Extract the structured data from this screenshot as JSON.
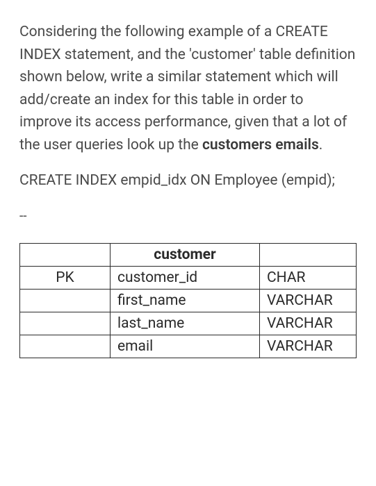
{
  "question": {
    "intro": "Considering the following example of a CREATE INDEX statement, and the 'customer' table definition shown below, write a similar statement which will add/create an index for this table in order to improve its access performance, given that a lot of the user queries look up the ",
    "bold_part": "customers emails",
    "tail": "."
  },
  "code_example": "CREATE INDEX empid_idx ON Employee (empid);",
  "separator": "--",
  "table": {
    "title": "customer",
    "rows": [
      {
        "key": "PK",
        "name": "customer_id",
        "type": "CHAR"
      },
      {
        "key": "",
        "name": "first_name",
        "type": "VARCHAR"
      },
      {
        "key": "",
        "name": "last_name",
        "type": "VARCHAR"
      },
      {
        "key": "",
        "name": "email",
        "type": "VARCHAR"
      }
    ]
  }
}
